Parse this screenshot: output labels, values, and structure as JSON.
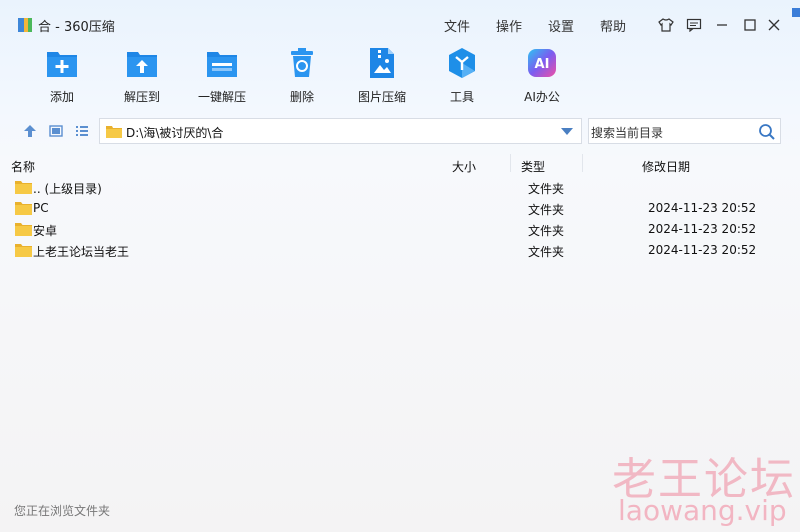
{
  "window": {
    "title": "合 - 360压缩"
  },
  "menu": [
    "文件",
    "操作",
    "设置",
    "帮助"
  ],
  "toolbar": [
    {
      "label": "添加",
      "icon": "add-icon"
    },
    {
      "label": "解压到",
      "icon": "extract-to-icon"
    },
    {
      "label": "一键解压",
      "icon": "one-click-extract-icon"
    },
    {
      "label": "删除",
      "icon": "delete-icon"
    },
    {
      "label": "图片压缩",
      "icon": "image-compress-icon"
    },
    {
      "label": "工具",
      "icon": "tools-icon"
    },
    {
      "label": "AI办公",
      "icon": "ai-office-icon"
    }
  ],
  "path": {
    "value": "D:\\海\\被讨厌的\\合"
  },
  "search": {
    "placeholder": "搜索当前目录"
  },
  "columns": {
    "name": "名称",
    "size": "大小",
    "type": "类型",
    "date": "修改日期"
  },
  "rows": [
    {
      "name": ".. (上级目录)",
      "size": "",
      "type": "文件夹",
      "date": ""
    },
    {
      "name": "PC",
      "size": "",
      "type": "文件夹",
      "date": "2024-11-23 20:52"
    },
    {
      "name": "安卓",
      "size": "",
      "type": "文件夹",
      "date": "2024-11-23 20:52"
    },
    {
      "name": "上老王论坛当老王",
      "size": "",
      "type": "文件夹",
      "date": "2024-11-23 20:52"
    }
  ],
  "status": {
    "text": "您正在浏览文件夹"
  },
  "watermark": {
    "line1": "老王论坛",
    "line2": "laowang.vip"
  },
  "colors": {
    "accent": "#2a8de8",
    "folder": "#f6c945"
  }
}
